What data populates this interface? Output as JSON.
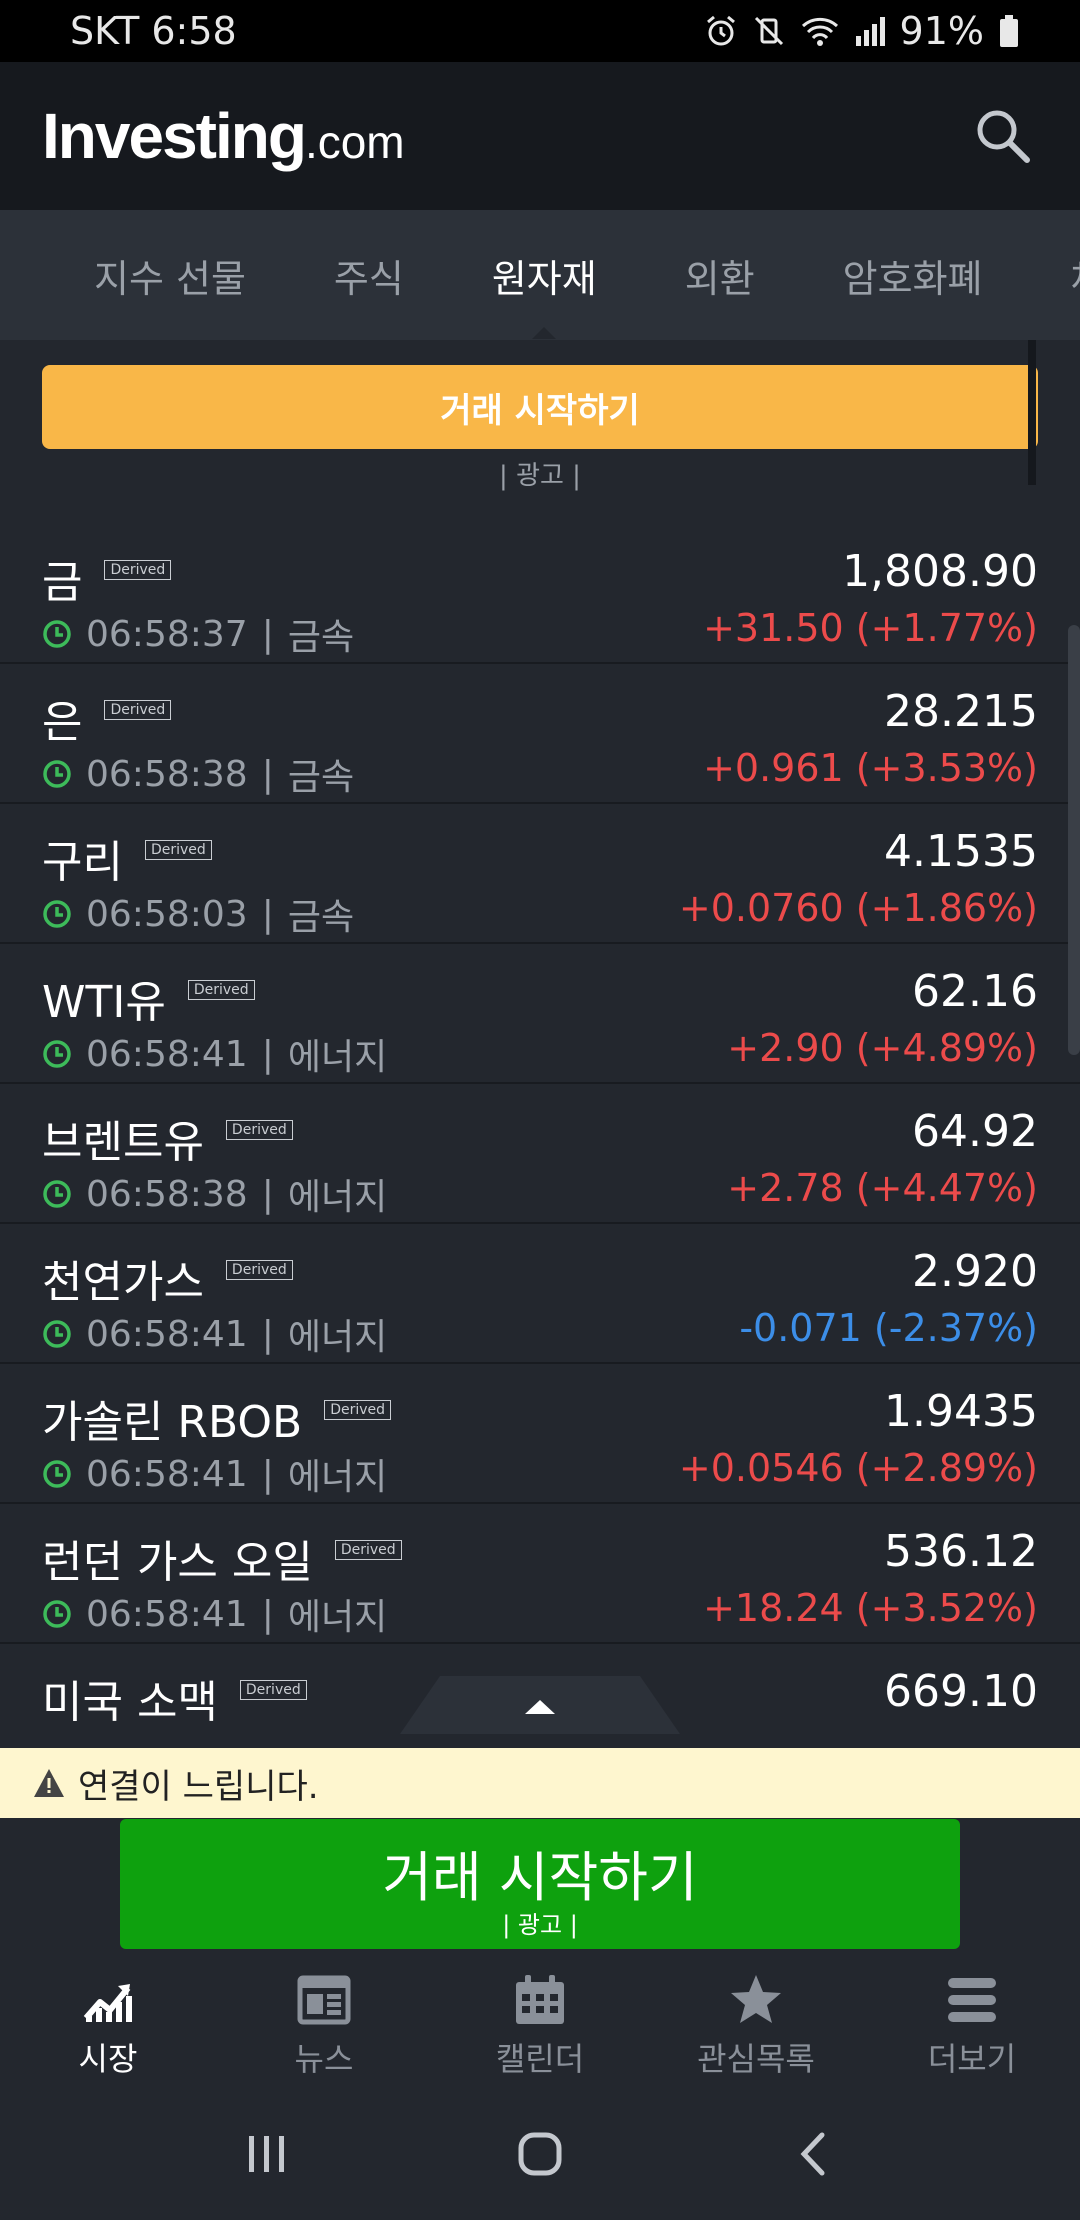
{
  "status_bar": {
    "carrier_time": "SKT 6:58",
    "battery": "91%"
  },
  "header": {
    "logo_main": "Investing",
    "logo_suffix": ".com"
  },
  "tabs": [
    {
      "label": "지수 선물"
    },
    {
      "label": "주식"
    },
    {
      "label": "원자재"
    },
    {
      "label": "외환"
    },
    {
      "label": "암호화폐"
    },
    {
      "label": "채"
    }
  ],
  "ad_top": {
    "button_label": "거래 시작하기",
    "ad_label": "| 광고 |"
  },
  "commodities": [
    {
      "name": "금",
      "tag": "Derived",
      "time": "06:58:37",
      "category": "금속",
      "price": "1,808.90",
      "change": "+31.50 (+1.77%)",
      "direction": "up"
    },
    {
      "name": "은",
      "tag": "Derived",
      "time": "06:58:38",
      "category": "금속",
      "price": "28.215",
      "change": "+0.961 (+3.53%)",
      "direction": "up"
    },
    {
      "name": "구리",
      "tag": "Derived",
      "time": "06:58:03",
      "category": "금속",
      "price": "4.1535",
      "change": "+0.0760 (+1.86%)",
      "direction": "up"
    },
    {
      "name": "WTI유",
      "tag": "Derived",
      "time": "06:58:41",
      "category": "에너지",
      "price": "62.16",
      "change": "+2.90 (+4.89%)",
      "direction": "up"
    },
    {
      "name": "브렌트유",
      "tag": "Derived",
      "time": "06:58:38",
      "category": "에너지",
      "price": "64.92",
      "change": "+2.78 (+4.47%)",
      "direction": "up"
    },
    {
      "name": "천연가스",
      "tag": "Derived",
      "time": "06:58:41",
      "category": "에너지",
      "price": "2.920",
      "change": "-0.071 (-2.37%)",
      "direction": "down"
    },
    {
      "name": "가솔린 RBOB",
      "tag": "Derived",
      "time": "06:58:41",
      "category": "에너지",
      "price": "1.9435",
      "change": "+0.0546 (+2.89%)",
      "direction": "up"
    },
    {
      "name": "런던 가스 오일",
      "tag": "Derived",
      "time": "06:58:41",
      "category": "에너지",
      "price": "536.12",
      "change": "+18.24 (+3.52%)",
      "direction": "up"
    },
    {
      "name": "미국 소맥",
      "tag": "Derived",
      "time": "",
      "category": "",
      "price": "669.10",
      "change": "",
      "direction": "up"
    }
  ],
  "warning": {
    "text": "연결이 느립니다."
  },
  "ad_bottom": {
    "button_label": "거래 시작하기",
    "ad_label": "| 광고 |"
  },
  "bottom_nav": [
    {
      "label": "시장",
      "icon": "chart-icon",
      "active": true
    },
    {
      "label": "뉴스",
      "icon": "news-icon",
      "active": false
    },
    {
      "label": "캘린더",
      "icon": "calendar-icon",
      "active": false
    },
    {
      "label": "관심목록",
      "icon": "star-icon",
      "active": false
    },
    {
      "label": "더보기",
      "icon": "menu-icon",
      "active": false
    }
  ],
  "colors": {
    "positive": "#ec4b4b",
    "negative": "#3c8ee8",
    "ad_orange": "#f9b748",
    "ad_green": "#0ea10e",
    "warning_bg": "#fef6cf"
  }
}
